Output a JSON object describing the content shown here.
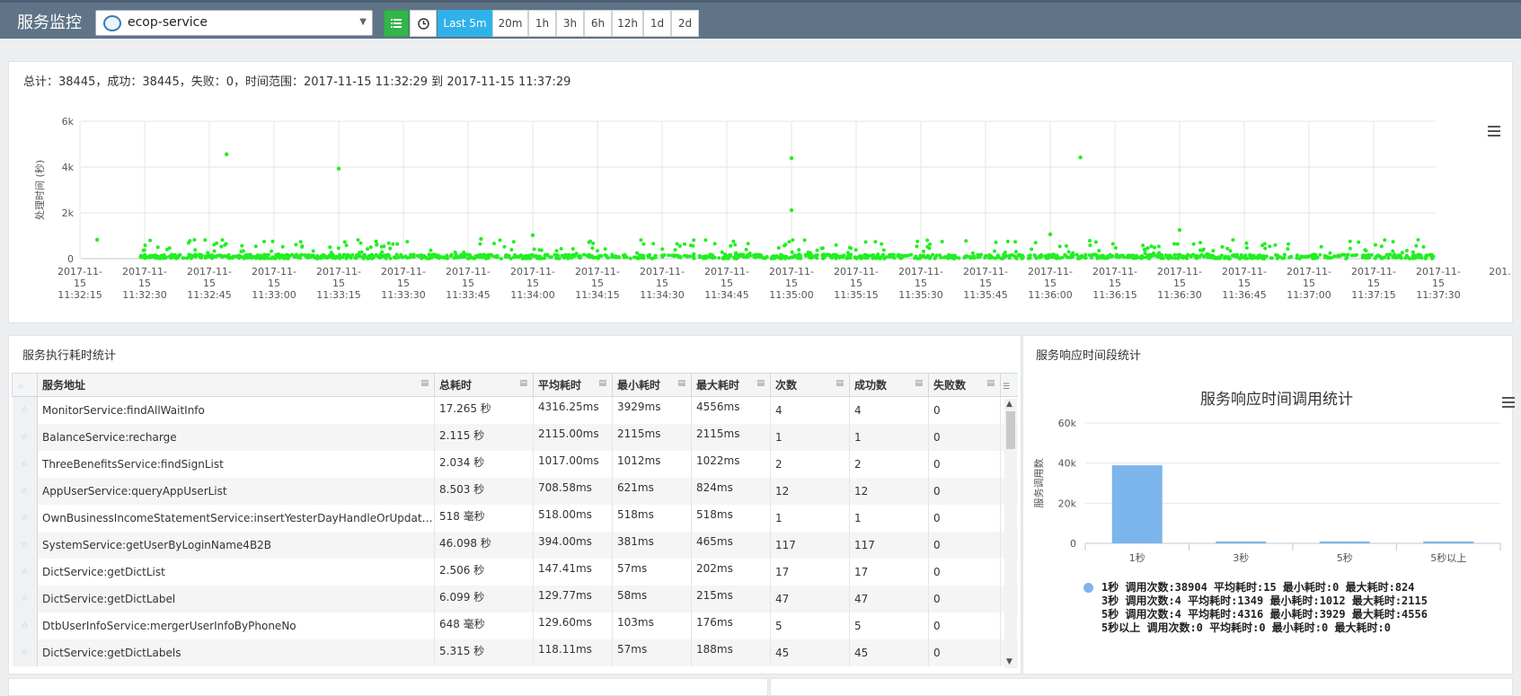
{
  "header": {
    "title": "服务监控",
    "service": "ecop-service",
    "time_buttons": [
      "Last 5m",
      "20m",
      "1h",
      "3h",
      "6h",
      "12h",
      "1d",
      "2d"
    ],
    "active_time": "Last 5m"
  },
  "summary": "总计：38445，成功：38445，失败：0，时间范围：2017-11-15 11:32:29 到 2017-11-15 11:37:29",
  "scatter": {
    "ylabel": "处理时间 (秒)",
    "y_ticks": [
      "6k",
      "4k",
      "2k",
      "0"
    ],
    "x_ticks": [
      [
        "2017-11-",
        "15",
        "11:32:15"
      ],
      [
        "2017-11-",
        "15",
        "11:32:30"
      ],
      [
        "2017-11-",
        "15",
        "11:32:45"
      ],
      [
        "2017-11-",
        "15",
        "11:33:00"
      ],
      [
        "2017-11-",
        "15",
        "11:33:15"
      ],
      [
        "2017-11-",
        "15",
        "11:33:30"
      ],
      [
        "2017-11-",
        "15",
        "11:33:45"
      ],
      [
        "2017-11-",
        "15",
        "11:34:00"
      ],
      [
        "2017-11-",
        "15",
        "11:34:15"
      ],
      [
        "2017-11-",
        "15",
        "11:34:30"
      ],
      [
        "2017-11-",
        "15",
        "11:34:45"
      ],
      [
        "2017-11-",
        "15",
        "11:35:00"
      ],
      [
        "2017-11-",
        "15",
        "11:35:15"
      ],
      [
        "2017-11-",
        "15",
        "11:35:30"
      ],
      [
        "2017-11-",
        "15",
        "11:35:45"
      ],
      [
        "2017-11-",
        "15",
        "11:36:00"
      ],
      [
        "2017-11-",
        "15",
        "11:36:15"
      ],
      [
        "2017-11-",
        "15",
        "11:36:30"
      ],
      [
        "2017-11-",
        "15",
        "11:36:45"
      ],
      [
        "2017-11-",
        "15",
        "11:37:00"
      ],
      [
        "2017-11-",
        "15",
        "11:37:15"
      ],
      [
        "2017-11-",
        "15",
        "11:37:30"
      ],
      [
        "201...",
        "",
        ""
      ]
    ],
    "color": "#22ee22",
    "outliers": [
      {
        "t": "11:32:49",
        "v": 4556
      },
      {
        "t": "11:33:15",
        "v": 3929
      },
      {
        "t": "11:35:00",
        "v": 4390
      },
      {
        "t": "11:36:07",
        "v": 4420
      },
      {
        "t": "11:35:00",
        "v": 2115
      },
      {
        "t": "11:36:30",
        "v": 1250
      },
      {
        "t": "11:36:00",
        "v": 1060
      },
      {
        "t": "11:34:00",
        "v": 1022
      },
      {
        "t": "11:32:19",
        "v": 824
      },
      {
        "t": "11:33:48",
        "v": 860
      }
    ]
  },
  "exec_table": {
    "title": "服务执行耗时统计",
    "columns": [
      "服务地址",
      "总耗时",
      "平均耗时",
      "最小耗时",
      "最大耗时",
      "次数",
      "成功数",
      "失败数"
    ],
    "rows": [
      [
        "MonitorService:findAllWaitInfo",
        "17.265 秒",
        "4316.25ms",
        "3929ms",
        "4556ms",
        "4",
        "4",
        "0"
      ],
      [
        "BalanceService:recharge",
        "2.115 秒",
        "2115.00ms",
        "2115ms",
        "2115ms",
        "1",
        "1",
        "0"
      ],
      [
        "ThreeBenefitsService:findSignList",
        "2.034 秒",
        "1017.00ms",
        "1012ms",
        "1022ms",
        "2",
        "2",
        "0"
      ],
      [
        "AppUserService:queryAppUserList",
        "8.503 秒",
        "708.58ms",
        "621ms",
        "824ms",
        "12",
        "12",
        "0"
      ],
      [
        "OwnBusinessIncomeStatementService:insertYesterDayHandleOrUpdateD...",
        "518 毫秒",
        "518.00ms",
        "518ms",
        "518ms",
        "1",
        "1",
        "0"
      ],
      [
        "SystemService:getUserByLoginName4B2B",
        "46.098 秒",
        "394.00ms",
        "381ms",
        "465ms",
        "117",
        "117",
        "0"
      ],
      [
        "DictService:getDictList",
        "2.506 秒",
        "147.41ms",
        "57ms",
        "202ms",
        "17",
        "17",
        "0"
      ],
      [
        "DictService:getDictLabel",
        "6.099 秒",
        "129.77ms",
        "58ms",
        "215ms",
        "47",
        "47",
        "0"
      ],
      [
        "DtbUserInfoService:mergerUserInfoByPhoneNo",
        "648 毫秒",
        "129.60ms",
        "103ms",
        "176ms",
        "5",
        "5",
        "0"
      ],
      [
        "DictService:getDictLabels",
        "5.315 秒",
        "118.11ms",
        "57ms",
        "188ms",
        "45",
        "45",
        "0"
      ]
    ]
  },
  "resp_chart": {
    "section_title": "服务响应时间段统计",
    "chart_data": {
      "type": "bar",
      "title": "服务响应时间调用统计",
      "ylabel": "服务调用数",
      "categories": [
        "1秒",
        "3秒",
        "5秒",
        "5秒以上"
      ],
      "values": [
        38904,
        4,
        4,
        0
      ],
      "y_ticks": [
        "60k",
        "40k",
        "20k",
        "0"
      ],
      "ylim": [
        0,
        60000
      ],
      "color": "#7cb5ec"
    },
    "legend_lines": [
      "1秒 调用次数:38904 平均耗时:15 最小耗时:0 最大耗时:824",
      "3秒 调用次数:4 平均耗时:1349 最小耗时:1012 最大耗时:2115",
      "5秒 调用次数:4 平均耗时:4316 最小耗时:3929 最大耗时:4556",
      "5秒以上 调用次数:0 平均耗时:0 最小耗时:0 最大耗时:0"
    ]
  }
}
